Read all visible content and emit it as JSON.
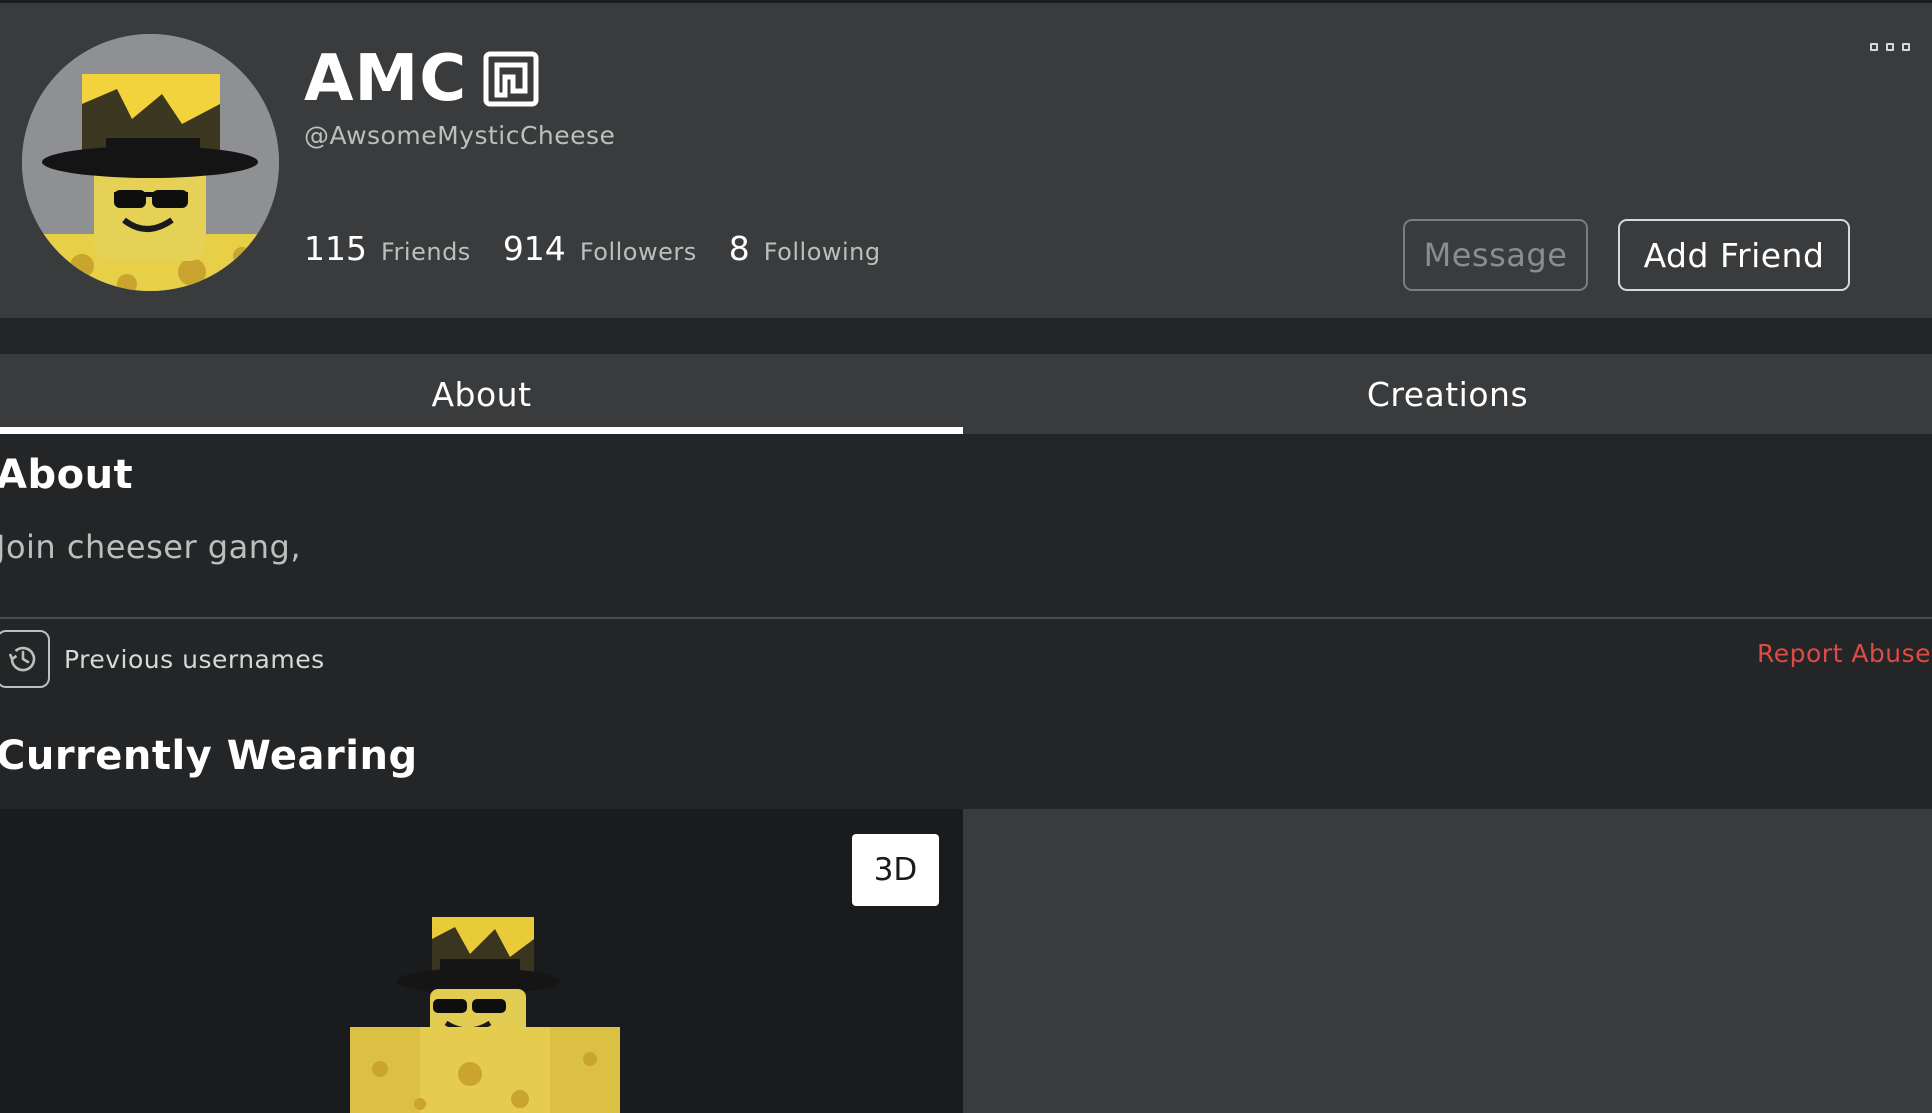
{
  "profile": {
    "display_name": "AMC",
    "username": "@AwsomeMysticCheese",
    "stats": [
      {
        "count": "115",
        "label": "Friends"
      },
      {
        "count": "914",
        "label": "Followers"
      },
      {
        "count": "8",
        "label": "Following"
      }
    ],
    "actions": {
      "message_label": "Message",
      "add_friend_label": "Add Friend"
    }
  },
  "tabs": [
    {
      "label": "About",
      "active": true
    },
    {
      "label": "Creations",
      "active": false
    }
  ],
  "about": {
    "heading": "About",
    "text": "Join cheeser gang,",
    "previous_usernames_label": "Previous usernames",
    "report_label": "Report Abuse"
  },
  "wearing": {
    "heading": "Currently Wearing",
    "toggle_3d_label": "3D"
  },
  "icons": {
    "premium": "premium-icon",
    "more": "more-options-icon",
    "history": "history-clock-icon"
  },
  "colors": {
    "background": "#232527",
    "card": "#393b3d",
    "viewer": "#191b1d",
    "report": "#e04a45",
    "muted_text": "#bdbebe"
  }
}
